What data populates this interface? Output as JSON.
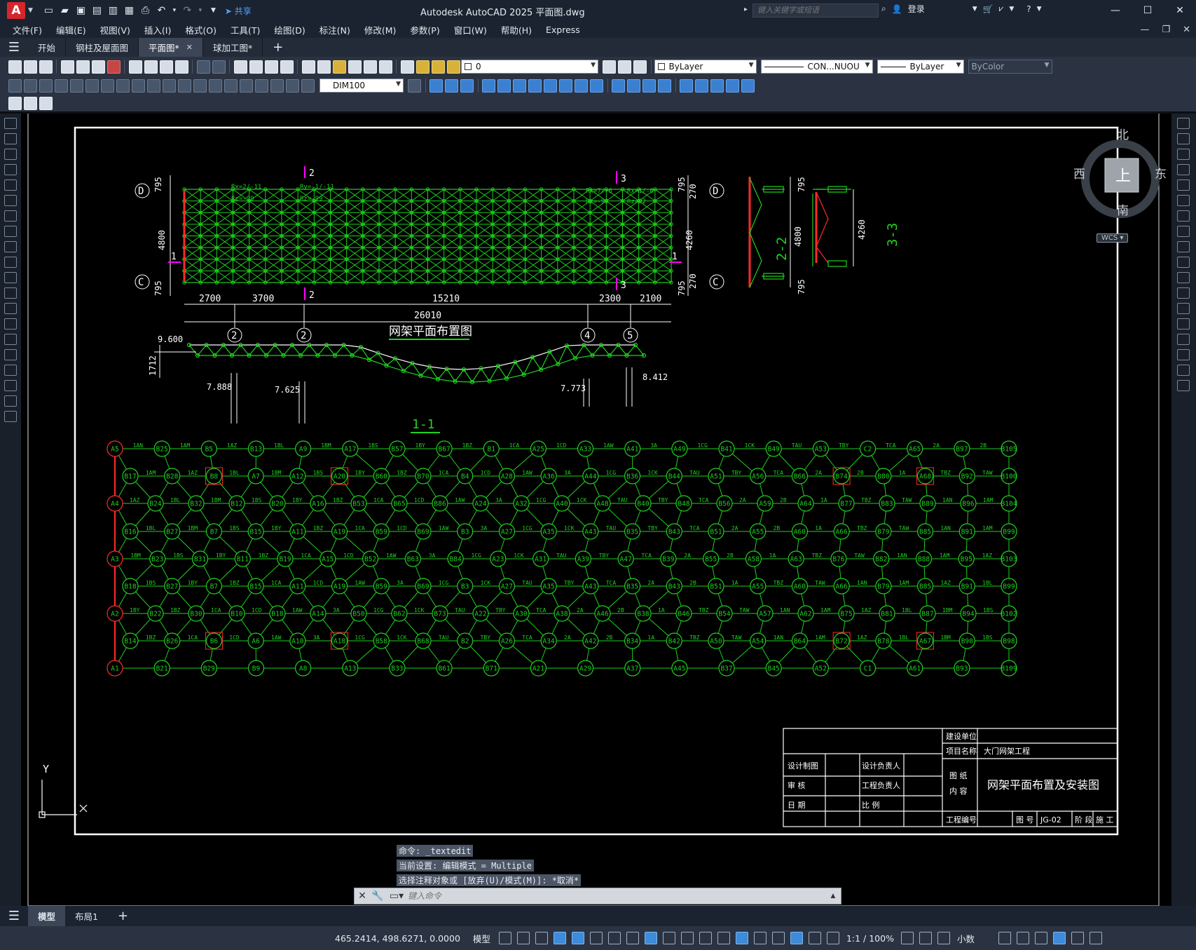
{
  "app": {
    "logo_letter": "A",
    "share_label": "共享",
    "window_title": "Autodesk AutoCAD 2025    平面图.dwg",
    "search_placeholder": "键入关键字或短语",
    "login_label": "登录"
  },
  "menu": [
    "文件(F)",
    "编辑(E)",
    "视图(V)",
    "插入(I)",
    "格式(O)",
    "工具(T)",
    "绘图(D)",
    "标注(N)",
    "修改(M)",
    "参数(P)",
    "窗口(W)",
    "帮助(H)",
    "Express"
  ],
  "file_tabs": [
    {
      "label": "开始",
      "active": false,
      "close": false
    },
    {
      "label": "钢柱及屋面图",
      "active": false,
      "close": false
    },
    {
      "label": "平面图*",
      "active": true,
      "close": true
    },
    {
      "label": "球加工图*",
      "active": false,
      "close": false
    }
  ],
  "toolbar": {
    "layer_value": "0",
    "color_value": "ByLayer",
    "linetype_value": "CON...NUOU",
    "lineweight_value": "ByLayer",
    "plotstyle_value": "ByColor",
    "dimstyle_value": "DIM100"
  },
  "viewcube": {
    "north": "北",
    "south": "南",
    "east": "东",
    "west": "西",
    "face": "上",
    "wcs": "WCS"
  },
  "drawing": {
    "plan_title": "网架平面布置图",
    "section_title": "1-1",
    "section2_label": "2-2",
    "section3_label": "3-3",
    "axis_D": "D",
    "axis_C": "C",
    "axis_2": "2",
    "axis_4": "4",
    "axis_5": "5",
    "dim_795": "795",
    "dim_4800": "4800",
    "dim_4260": "4260",
    "dim_270": "270",
    "dims_bottom": [
      "2700",
      "3700",
      "15210",
      "2300",
      "2100"
    ],
    "dim_total": "26010",
    "cut_1": "1",
    "cut_2": "2",
    "cut_3": "3",
    "support_labels": [
      "Rx=2/-11",
      "Ry=-1/-11",
      "Rz=-99",
      "Rx=7/-6",
      "Rx=1/-6",
      "Rz=92"
    ],
    "elevations": [
      "9.600",
      "7.888",
      "7.625",
      "7.773",
      "8.412"
    ],
    "height_dim": "1712",
    "grid_labels": {
      "top": [
        "A5",
        "B25",
        "B5",
        "B13",
        "A9",
        "A17",
        "B57",
        "B67",
        "B1",
        "A25",
        "A33",
        "A41",
        "A49",
        "B41",
        "B49",
        "A53",
        "C2",
        "A65",
        "B97",
        "B105"
      ],
      "bottom": [
        "A1",
        "B21",
        "B29",
        "B9",
        "A8",
        "A13",
        "B33",
        "B61",
        "B71",
        "A21",
        "A29",
        "A37",
        "A45",
        "B37",
        "B45",
        "A52",
        "C1",
        "A61",
        "B93",
        "B109"
      ],
      "row2": [
        "B17",
        "B28",
        "B8",
        "A7",
        "A12",
        "A20",
        "B60",
        "B70",
        "B4",
        "A28",
        "A36",
        "A44",
        "B36",
        "B44",
        "A51",
        "A56",
        "B66",
        "B74",
        "B80",
        "A68",
        "B92",
        "B100"
      ],
      "row3": [
        "A4",
        "B24",
        "B32",
        "B12",
        "B20",
        "A16",
        "B53",
        "B65",
        "B86",
        "A24",
        "A32",
        "A40",
        "A48",
        "B40",
        "B48",
        "B56",
        "A59",
        "A64",
        "B77",
        "B83",
        "B89",
        "B96",
        "B104"
      ],
      "row4": [
        "B16",
        "B27",
        "B7",
        "B15",
        "A11",
        "A19",
        "B59",
        "B69",
        "B3",
        "A27",
        "A35",
        "A43",
        "B35",
        "B43",
        "B51",
        "A55",
        "A60",
        "A66",
        "B79",
        "B85",
        "B91",
        "B99"
      ],
      "row5": [
        "A3",
        "B23",
        "B31",
        "B11",
        "B19",
        "A15",
        "B52",
        "B63",
        "B84",
        "A23",
        "A31",
        "A39",
        "A47",
        "B39",
        "B55",
        "A58",
        "A63",
        "B76",
        "B82",
        "B88",
        "B95",
        "B103"
      ],
      "row6": [
        "B18",
        "B27",
        "B7",
        "B15",
        "A11",
        "A19",
        "B59",
        "B69",
        "B3",
        "A27",
        "A35",
        "A43",
        "B35",
        "B43",
        "B51",
        "A55",
        "A60",
        "A66",
        "B79",
        "B85",
        "B91",
        "B99"
      ],
      "row7": [
        "A2",
        "B22",
        "B30",
        "B10",
        "B18",
        "A14",
        "B50",
        "B62",
        "B73",
        "A22",
        "A30",
        "A38",
        "A46",
        "B38",
        "B46",
        "B54",
        "A57",
        "A62",
        "B75",
        "B81",
        "B87",
        "B94",
        "B102"
      ],
      "row8": [
        "B14",
        "B26",
        "B6",
        "A6",
        "A10",
        "A18",
        "B58",
        "B68",
        "B2",
        "A26",
        "A34",
        "A42",
        "B34",
        "B42",
        "A50",
        "A54",
        "B64",
        "B72",
        "B78",
        "A67",
        "B90",
        "B98"
      ]
    },
    "member_labels": [
      "1AN",
      "1AM",
      "1AZ",
      "1BL",
      "1BM",
      "1BS",
      "1BY",
      "1BZ",
      "1CA",
      "1CD",
      "1AW",
      "3A",
      "1CG",
      "1CK",
      "TAU",
      "TBY",
      "TCA",
      "2A",
      "2B",
      "1A",
      "TBZ",
      "TAW"
    ]
  },
  "title_block": {
    "build_unit": "建设单位",
    "project_name_label": "项目名称",
    "project_name": "大门网架工程",
    "design_draw": "设计制图",
    "design_lead": "设计负责人",
    "drawing_content_label1": "图  纸",
    "drawing_content_label2": "内  容",
    "drawing_content": "网架平面布置及安装图",
    "review": "审  核",
    "project_lead": "工程负责人",
    "date": "日  期",
    "scale": "比  例",
    "project_no": "工程编号",
    "sheet_no": "图 号",
    "sheet_code": "JG-02",
    "stage": "阶 段",
    "construction": "施 工"
  },
  "command": {
    "history": [
      "命令: _textedit",
      "当前设置: 编辑模式 = Multiple",
      "选择注释对象或 [放弃(U)/模式(M)]: *取消*"
    ],
    "placeholder": "键入命令"
  },
  "layout_tabs": [
    {
      "label": "模型",
      "active": true
    },
    {
      "label": "布局1",
      "active": false
    }
  ],
  "status": {
    "coords": "465.2414, 498.6271, 0.0000",
    "model": "模型",
    "scale": "1:1 / 100%",
    "units": "小数"
  },
  "ucs": {
    "y_label": "Y"
  }
}
